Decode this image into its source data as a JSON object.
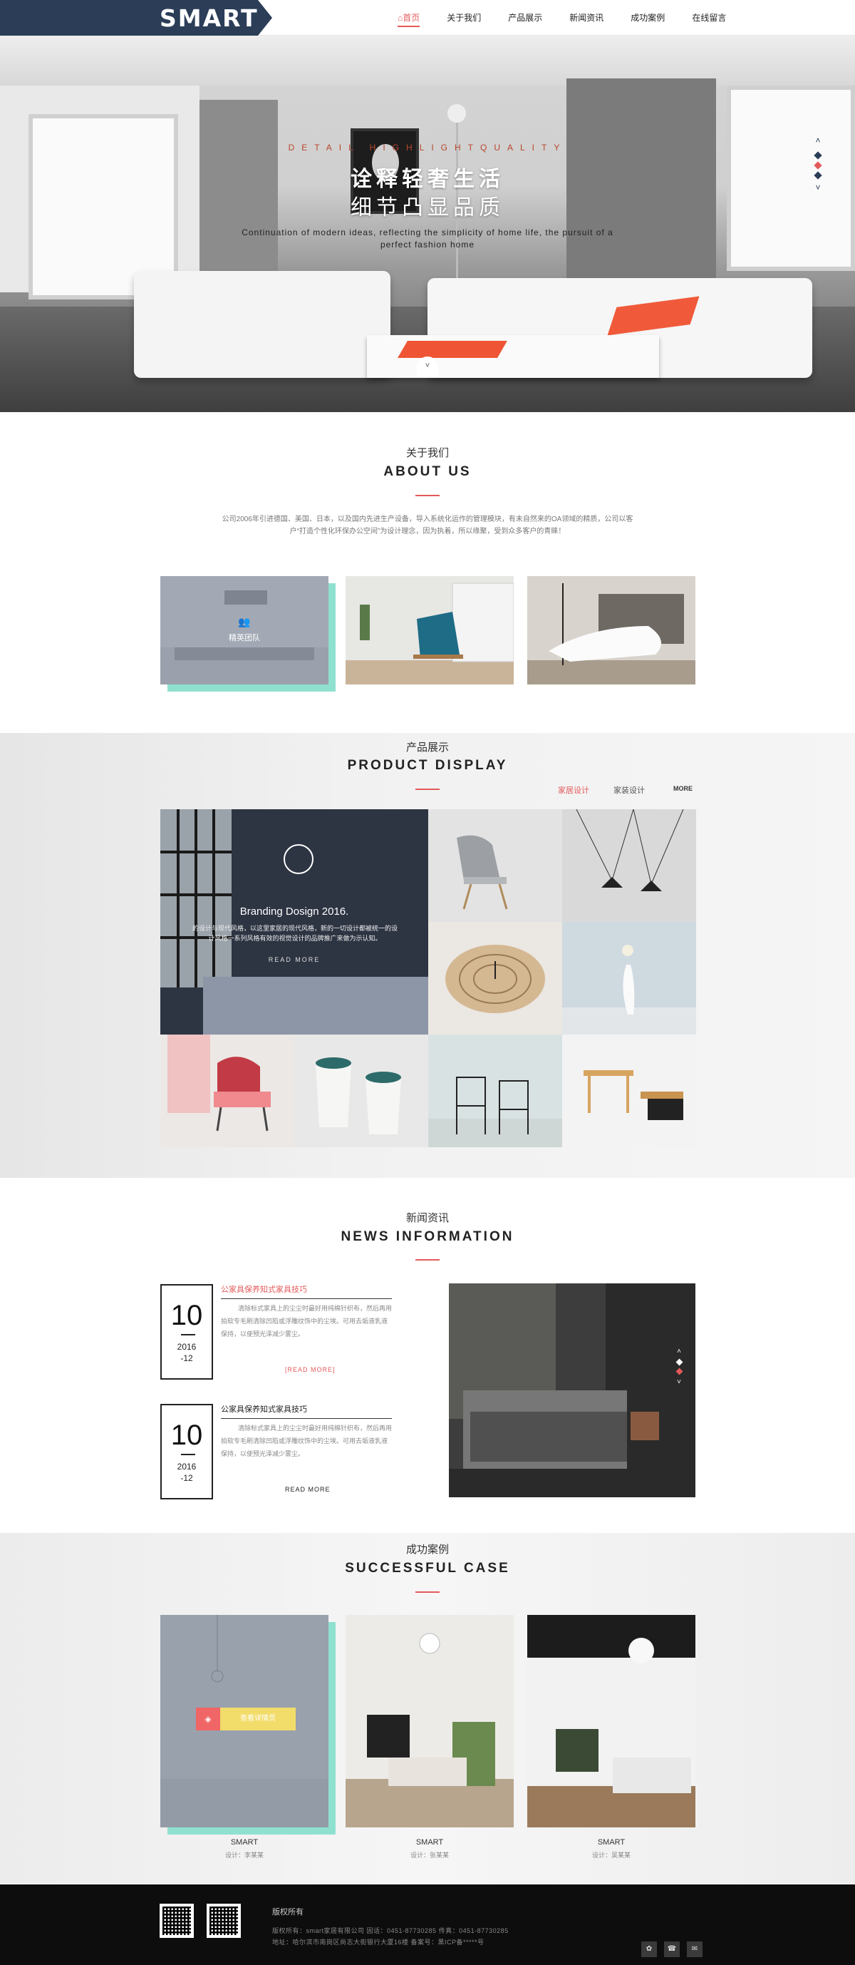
{
  "header": {
    "logo": "SMART",
    "nav": [
      {
        "label": "⌂首页",
        "active": true
      },
      {
        "label": "关于我们"
      },
      {
        "label": "产品展示"
      },
      {
        "label": "新闻资讯"
      },
      {
        "label": "成功案例"
      },
      {
        "label": "在线留言"
      }
    ]
  },
  "hero": {
    "tag": "DETAIL HIGHLIGHTQUALITY",
    "title1": "诠释轻奢生活",
    "title2": "细节凸显品质",
    "subtitle": "Continuation of modern ideas, reflecting the simplicity of home life, the pursuit of a perfect fashion home",
    "arrow_up": "˄",
    "arrow_down": "˅",
    "scroll": "˅"
  },
  "about": {
    "title_cn": "关于我们",
    "title_en": "ABOUT US",
    "desc": "公司2006年引进德国、美国、日本，以及国内先进生产设备，导入系统化运作的管理模块，有未自然来的OA领域的精质，公司以客户“打造个性化环保办公空间”为设计理念，因为执着，所以缘聚，受到众多客户的青睐！",
    "card_label": "精英团队"
  },
  "product": {
    "title_cn": "产品展示",
    "title_en": "PRODUCT DISPLAY",
    "tabs": [
      "家居设计",
      "家装设计"
    ],
    "more": "MORE",
    "feature_title": "Branding Dosign 2016.",
    "feature_desc": "的设计与现代风格，以这里家居的现代风格，新的一切设计都被统一的设计风格一系列风格有效的视觉设计的品牌推广来做为示认知。",
    "feature_more": "READ MORE"
  },
  "news": {
    "title_cn": "新闻资讯",
    "title_en": "NEWS INFORMATION",
    "items": [
      {
        "day": "10",
        "year": "2016",
        "month": "-12",
        "title": "公家具保养知式家具技巧",
        "text": "清除标式家具上的尘尘时最好用纯棉针织布，然后再用拍软专毛刷清除凹陷或浮雕纹饰中的尘埃。可用去垢液乳液保持，以使预光泽减少雾尘。",
        "more": "[READ MORE]",
        "highlight": true
      },
      {
        "day": "10",
        "year": "2016",
        "month": "-12",
        "title": "公家具保养知式家具技巧",
        "text": "清除标式家具上的尘尘时最好用纯棉针织布，然后再用拍软专毛刷清除凹陷或浮雕纹饰中的尘埃。可用去垢液乳液保持，以使预光泽减少雾尘。",
        "more": "READ MORE",
        "highlight": false
      }
    ],
    "slider_up": "˄",
    "slider_down": "˅"
  },
  "cases": {
    "title_cn": "成功案例",
    "title_en": "SUCCESSFUL CASE",
    "btn_icon": "◈",
    "btn_label": "查看详情页",
    "items": [
      {
        "name": "SMART",
        "designer": "设计：李某某"
      },
      {
        "name": "SMART",
        "designer": "设计：张某某"
      },
      {
        "name": "SMART",
        "designer": "设计：吴某某"
      }
    ]
  },
  "footer": {
    "title": "版权所有",
    "line1": "版权所有：smart家居有限公司   固话：0451-87730285   传真：0451-87730285",
    "line2": "地址：哈尔滨市南岗区尚志大街银行大厦16楼   备案号：黑ICP备*****号",
    "icons": [
      "✿",
      "☎",
      "✉"
    ]
  },
  "colors": {
    "accent": "#e35a5a",
    "navy": "#2b3d57",
    "mint": "#8fe0cf"
  }
}
